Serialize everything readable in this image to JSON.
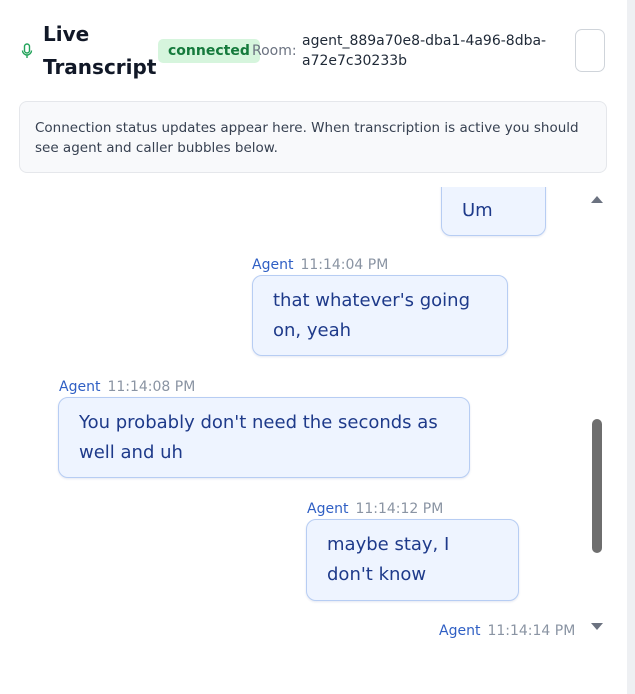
{
  "header": {
    "icon": "microphone-icon",
    "title": "Live Transcript",
    "status": "connected",
    "room_label": "Room:",
    "room_id": "agent_889a70e8-dba1-4a96-8dba-a72e7c30233b"
  },
  "status_message": "Connection status updates appear here. When transcription is active you should see agent and caller bubbles below.",
  "messages": [
    {
      "speaker": "",
      "time": "",
      "text": "Um"
    },
    {
      "speaker": "Agent",
      "time": "11:14:04 PM",
      "text": "that whatever's going on, yeah"
    },
    {
      "speaker": "Agent",
      "time": "11:14:08 PM",
      "text": "You probably don't need the seconds as well and uh"
    },
    {
      "speaker": "Agent",
      "time": "11:14:12 PM",
      "text": "maybe stay, I don't know"
    },
    {
      "speaker": "Agent",
      "time": "11:14:14 PM",
      "text": ""
    }
  ],
  "colors": {
    "badge_bg": "#d6f5dd",
    "badge_text": "#157a3c",
    "bubble_bg": "#eef4ff",
    "bubble_border": "#b7cdf3",
    "bubble_text": "#1e3a8a",
    "speaker_text": "#2f5fc4"
  }
}
